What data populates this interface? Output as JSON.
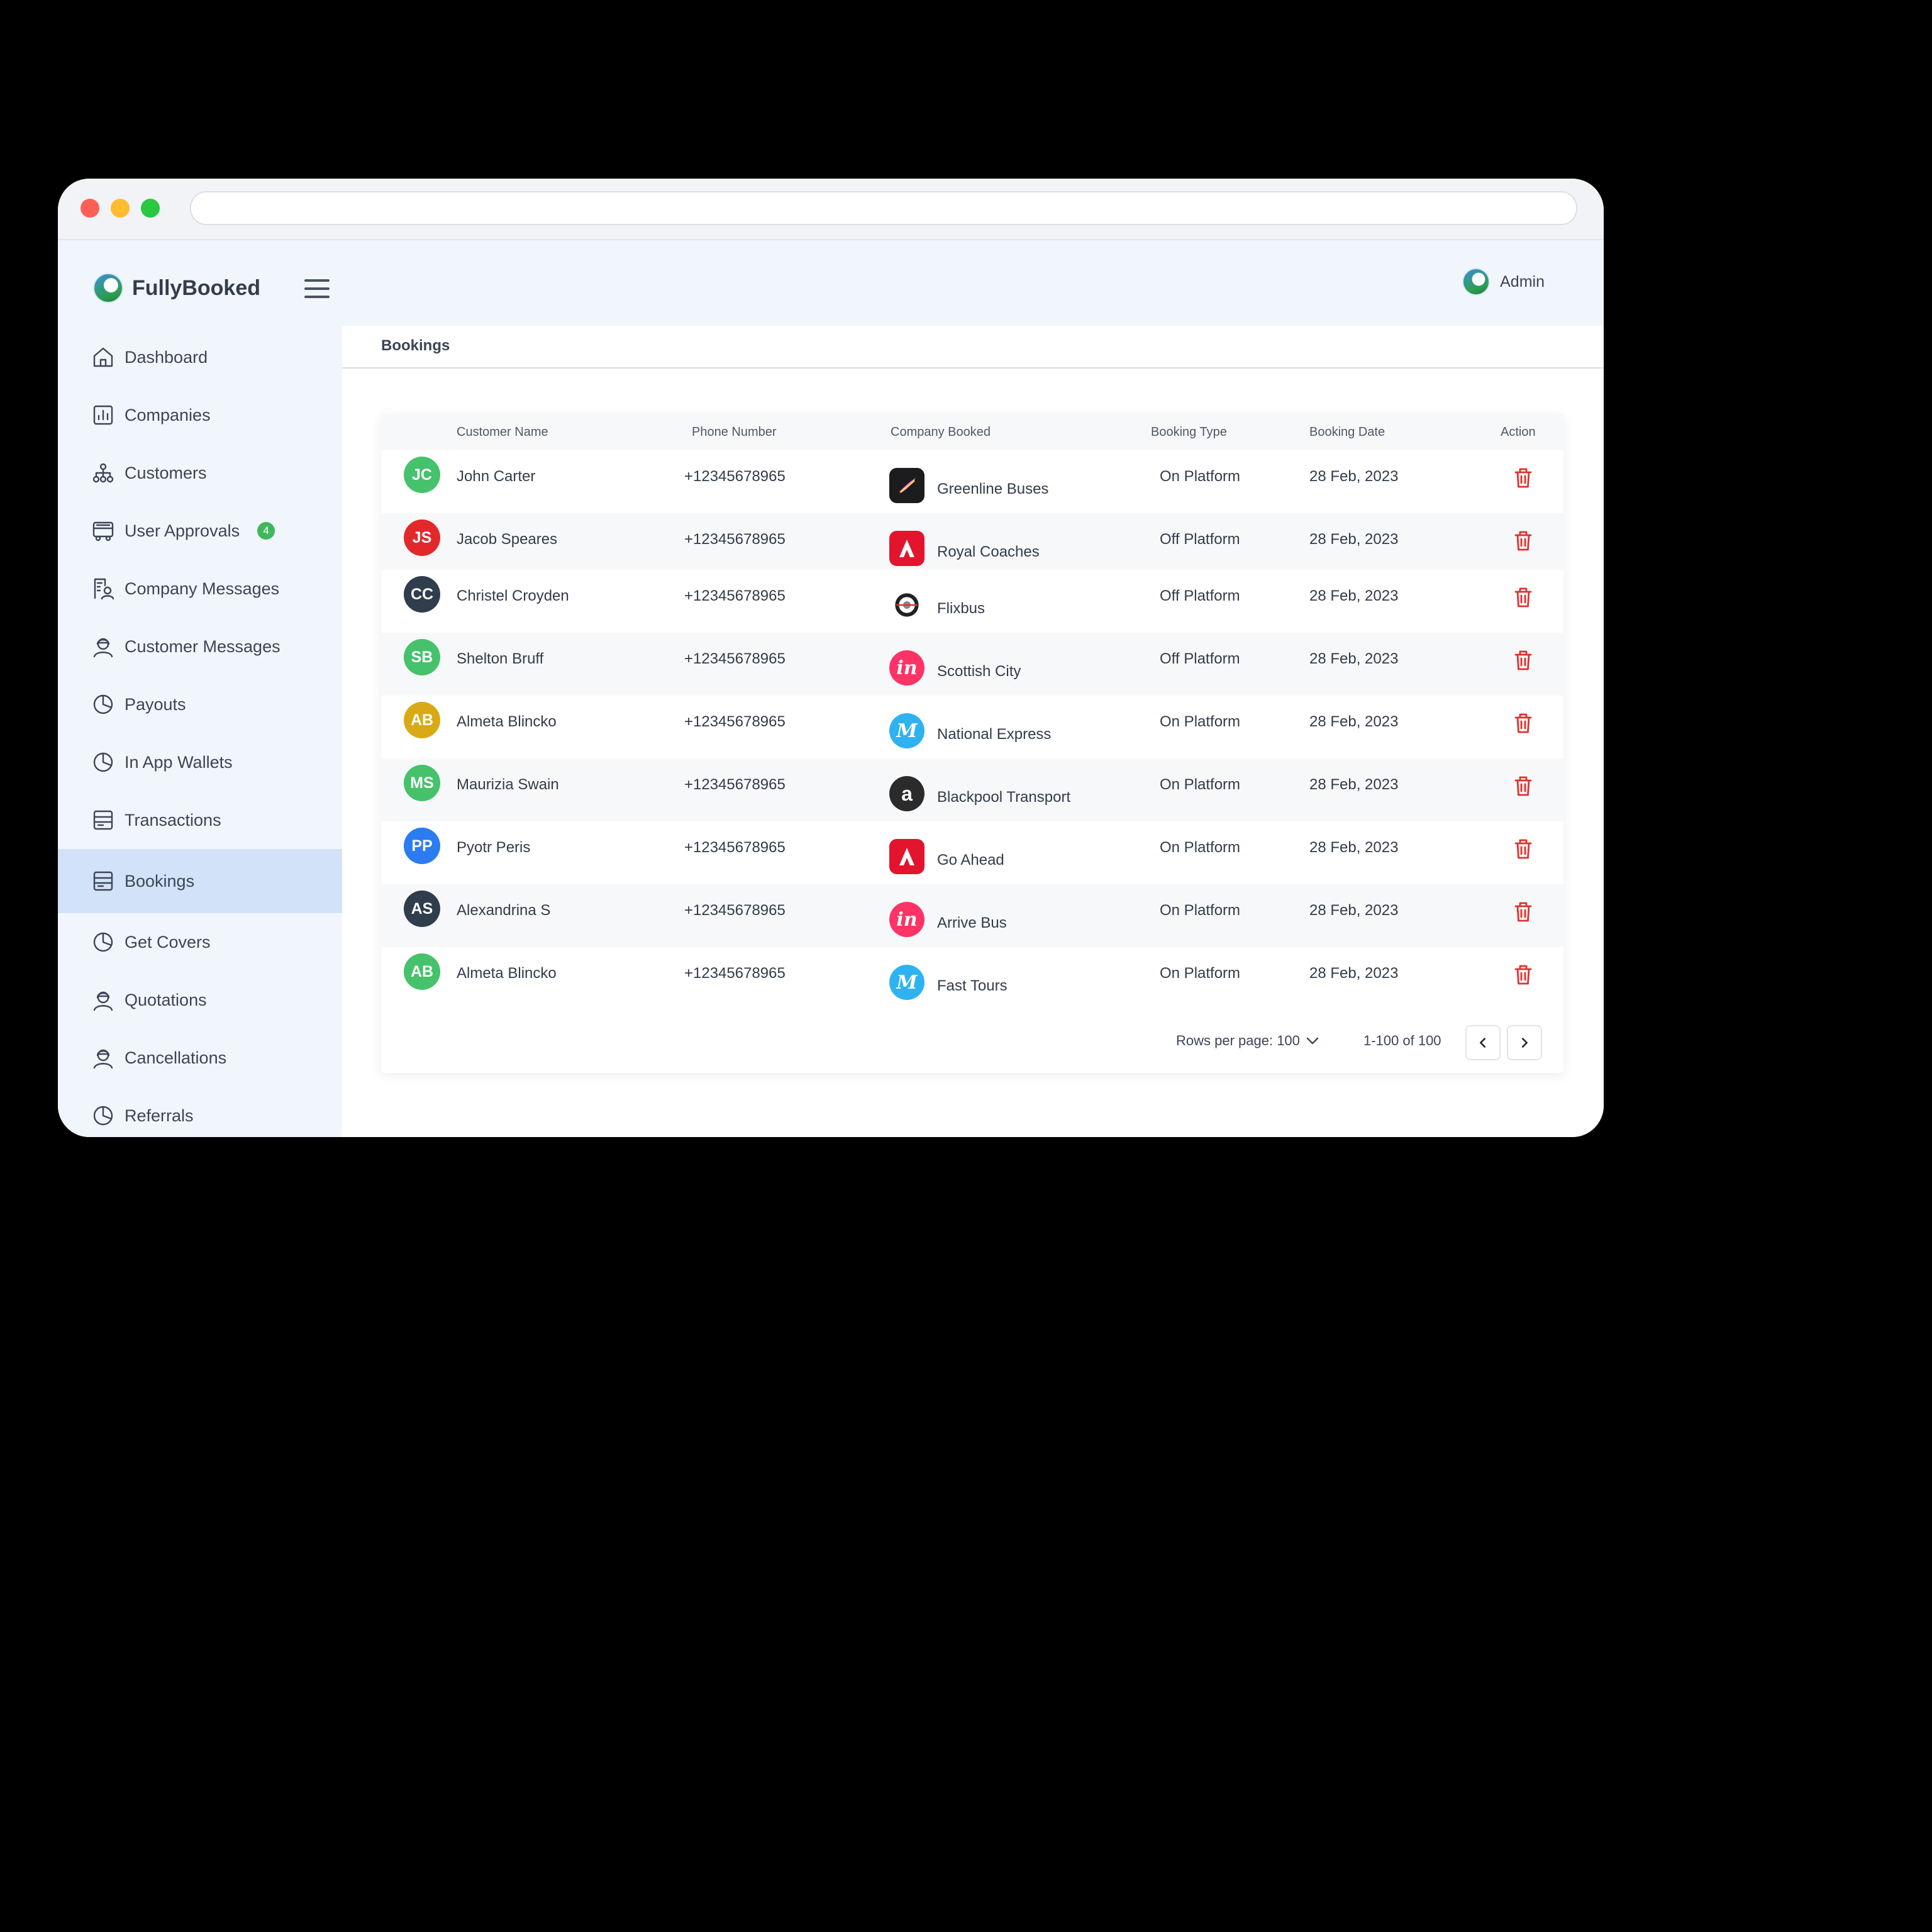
{
  "app": {
    "brand": "FullyBooked",
    "admin_label": "Admin",
    "page_title": "Bookings"
  },
  "sidebar": {
    "items": [
      {
        "label": "Dashboard",
        "icon": "home-icon"
      },
      {
        "label": "Companies",
        "icon": "chart-box-icon"
      },
      {
        "label": "Customers",
        "icon": "org-chart-icon"
      },
      {
        "label": "User Approvals",
        "icon": "bus-icon",
        "badge": "4"
      },
      {
        "label": "Company Messages",
        "icon": "doc-user-icon"
      },
      {
        "label": "Customer Messages",
        "icon": "support-agent-icon"
      },
      {
        "label": "Payouts",
        "icon": "pie-chart-icon"
      },
      {
        "label": "In App Wallets",
        "icon": "pie-chart-icon"
      },
      {
        "label": "Transactions",
        "icon": "receipt-box-icon"
      },
      {
        "label": "Bookings",
        "icon": "receipt-box-icon",
        "active": true
      },
      {
        "label": "Get Covers",
        "icon": "pie-chart-icon"
      },
      {
        "label": "Quotations",
        "icon": "support-agent-icon"
      },
      {
        "label": "Cancellations",
        "icon": "support-agent-icon"
      },
      {
        "label": "Referrals",
        "icon": "pie-chart-icon"
      }
    ]
  },
  "table": {
    "columns": [
      "Customer Name",
      "Phone Number",
      "Company Booked",
      "Booking Type",
      "Booking Date",
      "Action"
    ],
    "rows": [
      {
        "initials": "JC",
        "avatar_color": "#45c26b",
        "name": "John Carter",
        "phone": "+12345678965",
        "company": "Greenline Buses",
        "logo": "procreate-logo",
        "type": "On Platform",
        "date": "28 Feb, 2023"
      },
      {
        "initials": "JS",
        "avatar_color": "#e3282b",
        "name": "Jacob Speares",
        "phone": "+12345678965",
        "company": "Royal Coaches",
        "logo": "adobe-logo",
        "type": "Off Platform",
        "date": "28 Feb, 2023"
      },
      {
        "initials": "CC",
        "avatar_color": "#2f3d4c",
        "name": "Christel Croyden",
        "phone": "+12345678965",
        "company": "Flixbus",
        "logo": "bus-wheel-logo",
        "type": "Off Platform",
        "date": "28 Feb, 2023"
      },
      {
        "initials": "SB",
        "avatar_color": "#45c26b",
        "name": "Shelton Bruff",
        "phone": "+12345678965",
        "company": "Scottish City",
        "logo": "invision-logo",
        "type": "Off Platform",
        "date": "28 Feb, 2023"
      },
      {
        "initials": "AB",
        "avatar_color": "#d9aa16",
        "name": "Almeta Blincko",
        "phone": "+12345678965",
        "company": "National Express",
        "logo": "m-logo",
        "type": "On Platform",
        "date": "28 Feb, 2023"
      },
      {
        "initials": "MS",
        "avatar_color": "#45c26b",
        "name": "Maurizia Swain",
        "phone": "+12345678965",
        "company": "Blackpool Transport",
        "logo": "amazon-logo",
        "type": "On Platform",
        "date": "28 Feb, 2023"
      },
      {
        "initials": "PP",
        "avatar_color": "#2b7cf0",
        "name": "Pyotr Peris",
        "phone": "+12345678965",
        "company": "Go Ahead",
        "logo": "adobe-logo",
        "type": "On Platform",
        "date": "28 Feb, 2023"
      },
      {
        "initials": "AS",
        "avatar_color": "#2f3d4c",
        "name": "Alexandrina S",
        "phone": "+12345678965",
        "company": "Arrive Bus",
        "logo": "invision-logo",
        "type": "On Platform",
        "date": "28 Feb, 2023"
      },
      {
        "initials": "AB",
        "avatar_color": "#45c26b",
        "name": "Almeta Blincko",
        "phone": "+12345678965",
        "company": "Fast Tours",
        "logo": "m-logo",
        "type": "On Platform",
        "date": "28 Feb, 2023"
      }
    ]
  },
  "pagination": {
    "rows_per_page_label": "Rows per page: 100",
    "range_label": "1-100 of 100"
  },
  "colors": {
    "sidebar_bg": "#f1f6fd",
    "active_bg": "#d2e2f8",
    "delete": "#e0312d",
    "badge": "#3fb85d"
  }
}
